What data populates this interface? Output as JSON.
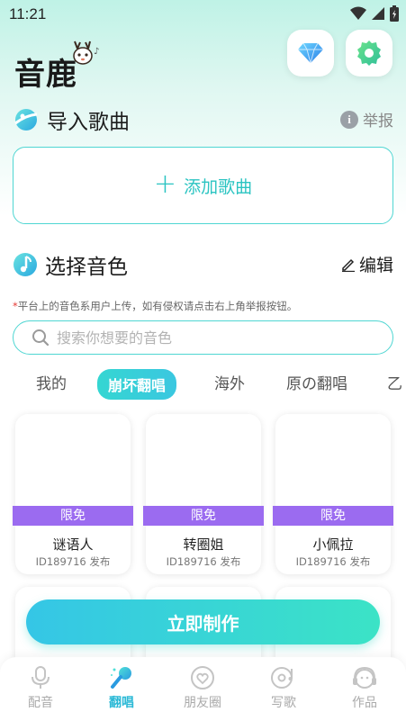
{
  "status": {
    "time": "11:21"
  },
  "app": {
    "logo_text": "音鹿"
  },
  "import_section": {
    "title": "导入歌曲",
    "report_label": "举报",
    "add_song_label": "添加歌曲"
  },
  "voice_section": {
    "title": "选择音色",
    "edit_label": "编辑",
    "notice_star": "*",
    "notice": "平台上的音色系用户上传，如有侵权请点击右上角举报按钮。",
    "search_placeholder": "搜索你想要的音色"
  },
  "tabs": [
    {
      "label": "我的",
      "active": false
    },
    {
      "label": "崩坏翻唱",
      "active": true
    },
    {
      "label": "海外",
      "active": false
    },
    {
      "label": "原の翻唱",
      "active": false
    },
    {
      "label": "乙",
      "active": false
    }
  ],
  "cards": [
    {
      "tag": "限免",
      "name": "谜语人",
      "meta": "ID189716 发布"
    },
    {
      "tag": "限免",
      "name": "转圈姐",
      "meta": "ID189716 发布"
    },
    {
      "tag": "限免",
      "name": "小佩拉",
      "meta": "ID189716 发布"
    }
  ],
  "make_button": {
    "label": "立即制作"
  },
  "bottom_nav": [
    {
      "label": "配音",
      "icon": "microphone-icon",
      "active": false
    },
    {
      "label": "翻唱",
      "icon": "sing-icon",
      "active": true
    },
    {
      "label": "朋友圈",
      "icon": "friends-icon",
      "active": false
    },
    {
      "label": "写歌",
      "icon": "record-icon",
      "active": false
    },
    {
      "label": "作品",
      "icon": "works-icon",
      "active": false
    }
  ],
  "colors": {
    "accent": "#35d6d2",
    "tag_purple": "#9b6bf0",
    "active_nav": "#2bb9d6"
  }
}
